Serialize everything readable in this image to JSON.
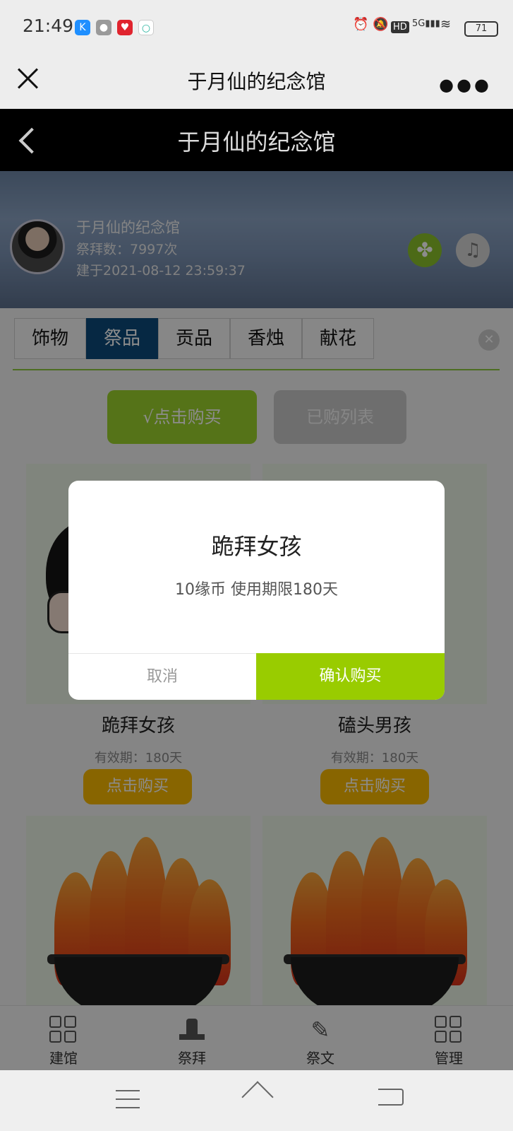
{
  "status_bar": {
    "time": "21:49",
    "battery": "71",
    "network": "5G"
  },
  "topbar": {
    "title": "于月仙的纪念馆"
  },
  "page_header": {
    "title": "于月仙的纪念馆"
  },
  "profile": {
    "name": "于月仙的纪念馆",
    "worship_count": "祭拜数：7997次",
    "built_date": "建于2021-08-12 23:59:37"
  },
  "tabs": [
    {
      "label": "饰物",
      "active": false
    },
    {
      "label": "祭品",
      "active": true
    },
    {
      "label": "贡品",
      "active": false
    },
    {
      "label": "香烛",
      "active": false
    },
    {
      "label": "献花",
      "active": false
    }
  ],
  "actions": {
    "buy": "√点击购买",
    "purchased_list": "已购列表"
  },
  "items": [
    {
      "name": "跪拜女孩",
      "validity": "有效期：180天",
      "buy_label": "点击购买"
    },
    {
      "name": "磕头男孩",
      "validity": "有效期：180天",
      "buy_label": "点击购买"
    }
  ],
  "modal": {
    "title": "跪拜女孩",
    "description": "10缘币 使用期限180天",
    "cancel": "取消",
    "confirm": "确认购买"
  },
  "bottom_nav": [
    {
      "label": "建馆",
      "icon": "grid-icon"
    },
    {
      "label": "祭拜",
      "icon": "altar-icon"
    },
    {
      "label": "祭文",
      "icon": "pen-icon"
    },
    {
      "label": "管理",
      "icon": "grid-icon"
    }
  ],
  "colors": {
    "accent_green": "#99cc00",
    "tab_active": "#0b4a7a",
    "buy_orange": "#f7b800"
  }
}
